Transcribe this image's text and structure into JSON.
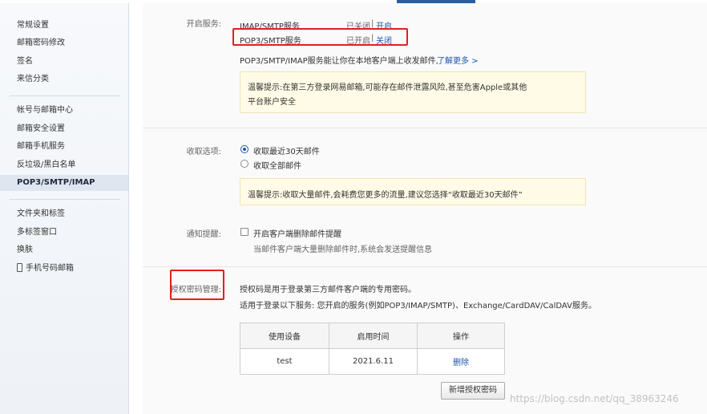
{
  "sidebar": {
    "group1": [
      "常规设置",
      "邮箱密码修改",
      "签名",
      "来信分类"
    ],
    "group2": [
      "帐号与邮箱中心",
      "邮箱安全设置",
      "邮箱手机服务",
      "反垃圾/黑白名单",
      "POP3/SMTP/IMAP"
    ],
    "group3": [
      "文件夹和标签",
      "多标签窗口",
      "换肤",
      "手机号码邮箱"
    ],
    "active": "POP3/SMTP/IMAP"
  },
  "services": {
    "label": "开启服务:",
    "rows": [
      {
        "name": "IMAP/SMTP服务",
        "status": "已关闭",
        "action": "开启"
      },
      {
        "name": "POP3/SMTP服务",
        "status": "已开启",
        "action": "关闭"
      }
    ],
    "separator": "|",
    "desc": "POP3/SMTP/IMAP服务能让你在本地客户端上收发邮件,",
    "learn_more": "了解更多 >",
    "tip_line1": "温馨提示:在第三方登录网易邮箱,可能存在邮件泄露风险,甚至危害Apple或其他",
    "tip_line2": "平台账户安全"
  },
  "receive": {
    "label": "收取选项:",
    "option1": "收取最近30天邮件",
    "option2": "收取全部邮件",
    "selected": "option1",
    "tip": "温馨提示:收取大量邮件,会耗费您更多的流量,建议您选择“收取最近30天邮件”"
  },
  "notify": {
    "label": "通知提醒:",
    "checkbox_label": "开启客户端删除邮件提醒",
    "checked": false,
    "desc": "当邮件客户端大量删除邮件时,系统会发送提醒信息"
  },
  "auth": {
    "label": "授权密码管理:",
    "desc1": "授权码是用于登录第三方邮件客户端的专用密码。",
    "desc2": "适用于登录以下服务: 您开启的服务(例如POP3/IMAP/SMTP)、Exchange/CardDAV/CalDAV服务。",
    "table": {
      "headers": [
        "使用设备",
        "启用时间",
        "操作"
      ],
      "rows": [
        {
          "device": "test",
          "date": "2021.6.11",
          "action": "删除"
        }
      ]
    },
    "add_button": "新增授权密码"
  },
  "watermark": "https://blog.csdn.net/qq_38963246",
  "colors": {
    "link": "#1a56b0",
    "highlight": "#e02020",
    "tip_bg": "#fffbe6"
  }
}
